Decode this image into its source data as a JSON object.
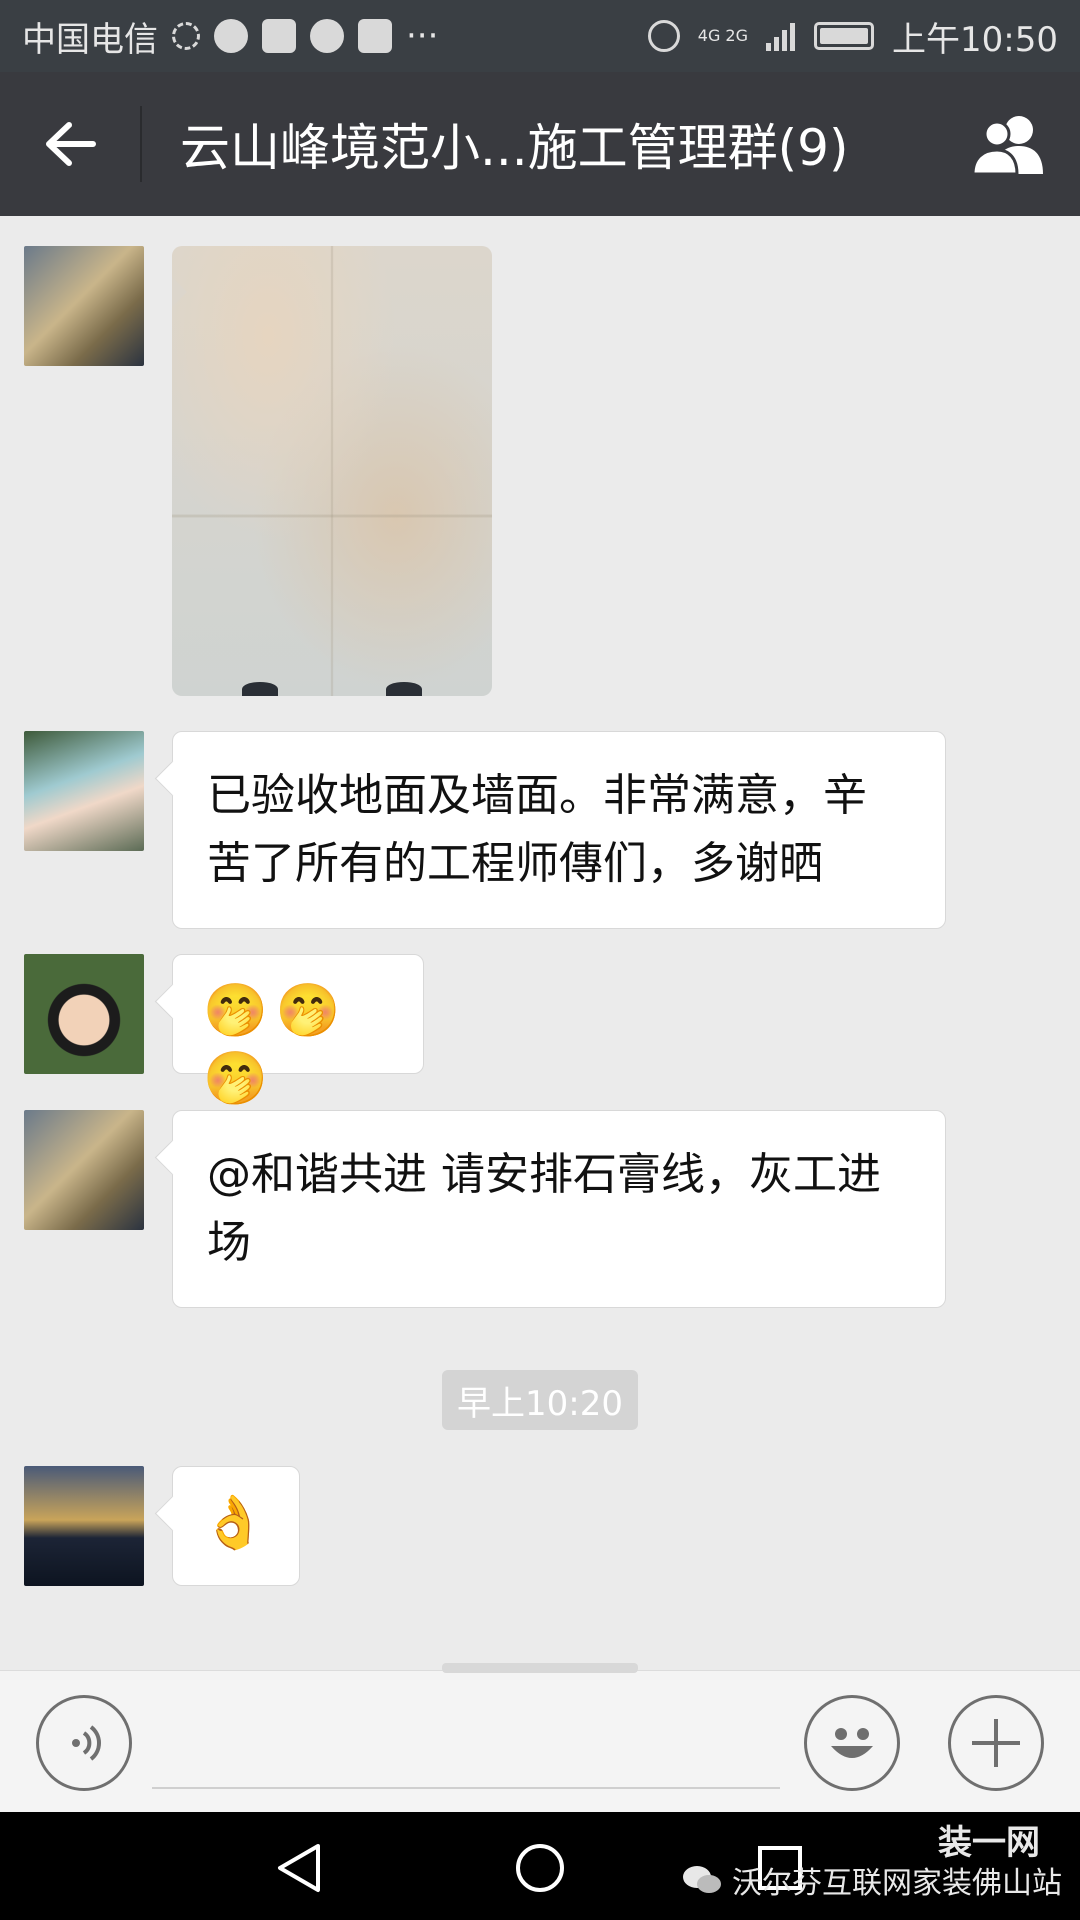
{
  "status_bar": {
    "carrier": "中国电信",
    "network": "4G 2G",
    "time": "上午10:50",
    "overflow": "···"
  },
  "header": {
    "back_icon": "arrow-left-icon",
    "title": "云山峰境范小...施工管理群(9)",
    "members_icon": "group-members-icon"
  },
  "messages": [
    {
      "type": "image",
      "avatar": "avatar-1",
      "description_icon": "photo-floor-tiles"
    },
    {
      "type": "text",
      "avatar": "avatar-2",
      "lines": [
        "已验收地面及墙面。非常满意，辛",
        "苦了所有的工程师傳们，多谢晒"
      ]
    },
    {
      "type": "emoji",
      "avatar": "avatar-3",
      "text": "🤭🤭🤭"
    },
    {
      "type": "text",
      "avatar": "avatar-1",
      "lines": [
        "@和谐共进 请安排石膏线，灰工进",
        "场"
      ]
    },
    {
      "type": "emoji",
      "avatar": "avatar-4",
      "text": "👌"
    }
  ],
  "timestamp": "早上10:20",
  "input_bar": {
    "voice_icon": "voice-icon",
    "emoji_icon": "smiley-icon",
    "plus_icon": "plus-icon"
  },
  "nav_bar": {
    "back_icon": "nav-back-icon",
    "home_icon": "nav-home-icon",
    "recents_icon": "nav-recents-icon"
  },
  "watermark": {
    "text": "沃尔芬互联网家装佛山站",
    "logo_text": "装一网"
  },
  "colors": {
    "header_bg": "#393a3f",
    "chat_bg": "#ebebeb",
    "bubble_bg": "#ffffff",
    "timestamp_bg": "#d4d4d4"
  }
}
